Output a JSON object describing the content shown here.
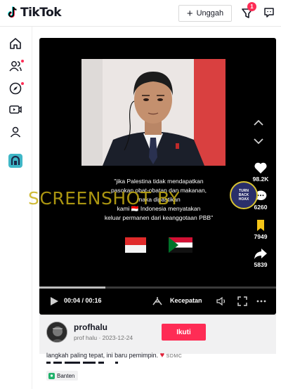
{
  "app": {
    "brand": "TikTok"
  },
  "header": {
    "upload_label": "Unggah",
    "inbox_badge": "1"
  },
  "sidebar": {
    "items": [
      {
        "name": "home-icon"
      },
      {
        "name": "following-icon",
        "dot": true
      },
      {
        "name": "explore-icon",
        "dot": true
      },
      {
        "name": "live-icon"
      },
      {
        "name": "profile-icon"
      },
      {
        "name": "app-icon"
      }
    ]
  },
  "video": {
    "caption_lines": [
      "\"jika Palestina tidak mendapatkan",
      "pasokan obat-obatan dan makanan,",
      "maka dipastikan",
      "kami 🇮🇩 Indonesia menyatakan",
      "keluar permanen dari keanggotaan PBB\""
    ],
    "likes": "98.2K",
    "comments": "6260",
    "saves": "7949",
    "shares": "5839",
    "time_current": "00:04",
    "time_total": "00:16",
    "time_display": "00:04 / 00:16",
    "progress": 0.28,
    "speed_label": "Kecepatan"
  },
  "watermark": {
    "text": "SCREENSHOT BY",
    "seal_text": "TURN BACK HOAX"
  },
  "author": {
    "username": "profhalu",
    "subline": "prof halu · 2023-12-24",
    "follow_label": "Ikuti"
  },
  "post": {
    "description": "langkah paling tepat, ini baru pemimpin.",
    "desc_tag": "SDMC",
    "location": "Banten"
  },
  "colors": {
    "accent": "#fe2c55",
    "video_bg": "#000000",
    "watermark": "#c8af14"
  }
}
